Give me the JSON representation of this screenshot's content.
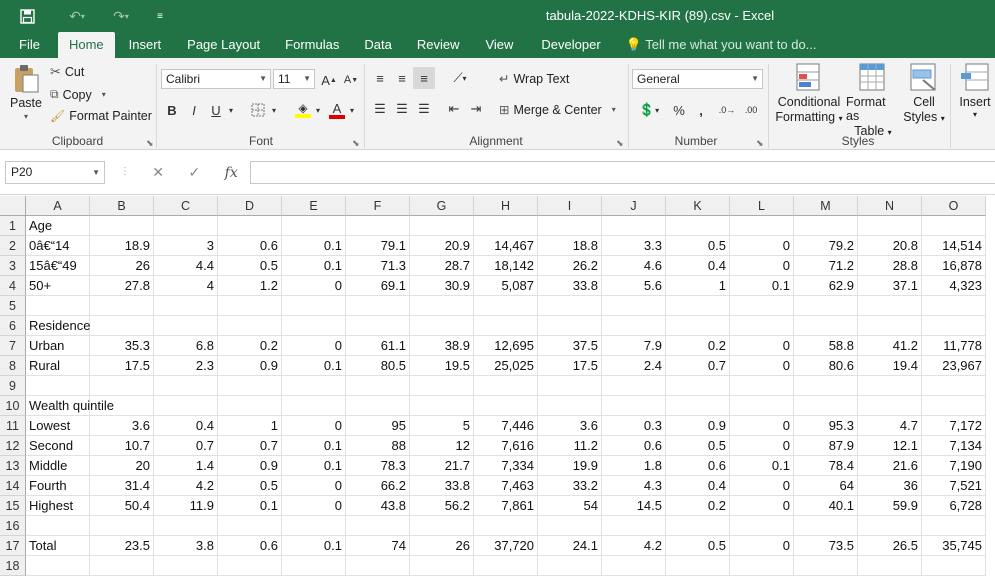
{
  "app": {
    "title": "tabula-2022-KDHS-KIR (89).csv - Excel",
    "quick_access": {
      "save_icon": "save-icon",
      "undo_icon": "undo-icon",
      "redo_icon": "redo-icon",
      "customize_icon": "customize-icon"
    }
  },
  "tabs": [
    "File",
    "Home",
    "Insert",
    "Page Layout",
    "Formulas",
    "Data",
    "Review",
    "View",
    "Developer"
  ],
  "tell_me": "Tell me what you want to do...",
  "ribbon": {
    "clipboard": {
      "paste": "Paste",
      "cut": "Cut",
      "copy": "Copy",
      "format_painter": "Format Painter",
      "label": "Clipboard"
    },
    "font": {
      "name": "Calibri",
      "size": "11",
      "bold": "B",
      "italic": "I",
      "underline": "U",
      "label": "Font"
    },
    "alignment": {
      "wrap_text": "Wrap Text",
      "merge_center": "Merge & Center",
      "label": "Alignment"
    },
    "number": {
      "format": "General",
      "percent": "%",
      "comma": ",",
      "label": "Number"
    },
    "styles": {
      "conditional": [
        "Conditional",
        "Formatting"
      ],
      "format_table": [
        "Format as",
        "Table"
      ],
      "cell_styles": [
        "Cell",
        "Styles"
      ],
      "label": "Styles"
    },
    "cells": {
      "insert": "Insert"
    }
  },
  "formula_bar": {
    "name_box": "P20",
    "formula": "",
    "fx": "fx"
  },
  "sheet": {
    "columns": [
      "A",
      "B",
      "C",
      "D",
      "E",
      "F",
      "G",
      "H",
      "I",
      "J",
      "K",
      "L",
      "M",
      "N",
      "O"
    ],
    "rows": [
      [
        "Age",
        "",
        "",
        "",
        "",
        "",
        "",
        "",
        "",
        "",
        "",
        "",
        "",
        "",
        ""
      ],
      [
        "0â€“14",
        "18.9",
        "3",
        "0.6",
        "0.1",
        "79.1",
        "20.9",
        "14,467",
        "18.8",
        "3.3",
        "0.5",
        "0",
        "79.2",
        "20.8",
        "14,514"
      ],
      [
        "15â€“49",
        "26",
        "4.4",
        "0.5",
        "0.1",
        "71.3",
        "28.7",
        "18,142",
        "26.2",
        "4.6",
        "0.4",
        "0",
        "71.2",
        "28.8",
        "16,878"
      ],
      [
        "50+",
        "27.8",
        "4",
        "1.2",
        "0",
        "69.1",
        "30.9",
        "5,087",
        "33.8",
        "5.6",
        "1",
        "0.1",
        "62.9",
        "37.1",
        "4,323"
      ],
      [
        "",
        "",
        "",
        "",
        "",
        "",
        "",
        "",
        "",
        "",
        "",
        "",
        "",
        "",
        ""
      ],
      [
        "Residence",
        "",
        "",
        "",
        "",
        "",
        "",
        "",
        "",
        "",
        "",
        "",
        "",
        "",
        ""
      ],
      [
        "Urban",
        "35.3",
        "6.8",
        "0.2",
        "0",
        "61.1",
        "38.9",
        "12,695",
        "37.5",
        "7.9",
        "0.2",
        "0",
        "58.8",
        "41.2",
        "11,778"
      ],
      [
        "Rural",
        "17.5",
        "2.3",
        "0.9",
        "0.1",
        "80.5",
        "19.5",
        "25,025",
        "17.5",
        "2.4",
        "0.7",
        "0",
        "80.6",
        "19.4",
        "23,967"
      ],
      [
        "",
        "",
        "",
        "",
        "",
        "",
        "",
        "",
        "",
        "",
        "",
        "",
        "",
        "",
        ""
      ],
      [
        "Wealth quintile",
        "",
        "",
        "",
        "",
        "",
        "",
        "",
        "",
        "",
        "",
        "",
        "",
        "",
        ""
      ],
      [
        "Lowest",
        "3.6",
        "0.4",
        "1",
        "0",
        "95",
        "5",
        "7,446",
        "3.6",
        "0.3",
        "0.9",
        "0",
        "95.3",
        "4.7",
        "7,172"
      ],
      [
        "Second",
        "10.7",
        "0.7",
        "0.7",
        "0.1",
        "88",
        "12",
        "7,616",
        "11.2",
        "0.6",
        "0.5",
        "0",
        "87.9",
        "12.1",
        "7,134"
      ],
      [
        "Middle",
        "20",
        "1.4",
        "0.9",
        "0.1",
        "78.3",
        "21.7",
        "7,334",
        "19.9",
        "1.8",
        "0.6",
        "0.1",
        "78.4",
        "21.6",
        "7,190"
      ],
      [
        "Fourth",
        "31.4",
        "4.2",
        "0.5",
        "0",
        "66.2",
        "33.8",
        "7,463",
        "33.2",
        "4.3",
        "0.4",
        "0",
        "64",
        "36",
        "7,521"
      ],
      [
        "Highest",
        "50.4",
        "11.9",
        "0.1",
        "0",
        "43.8",
        "56.2",
        "7,861",
        "54",
        "14.5",
        "0.2",
        "0",
        "40.1",
        "59.9",
        "6,728"
      ],
      [
        "",
        "",
        "",
        "",
        "",
        "",
        "",
        "",
        "",
        "",
        "",
        "",
        "",
        "",
        ""
      ],
      [
        "Total",
        "23.5",
        "3.8",
        "0.6",
        "0.1",
        "74",
        "26",
        "37,720",
        "24.1",
        "4.2",
        "0.5",
        "0",
        "73.5",
        "26.5",
        "35,745"
      ],
      [
        "",
        "",
        "",
        "",
        "",
        "",
        "",
        "",
        "",
        "",
        "",
        "",
        "",
        "",
        ""
      ]
    ]
  }
}
